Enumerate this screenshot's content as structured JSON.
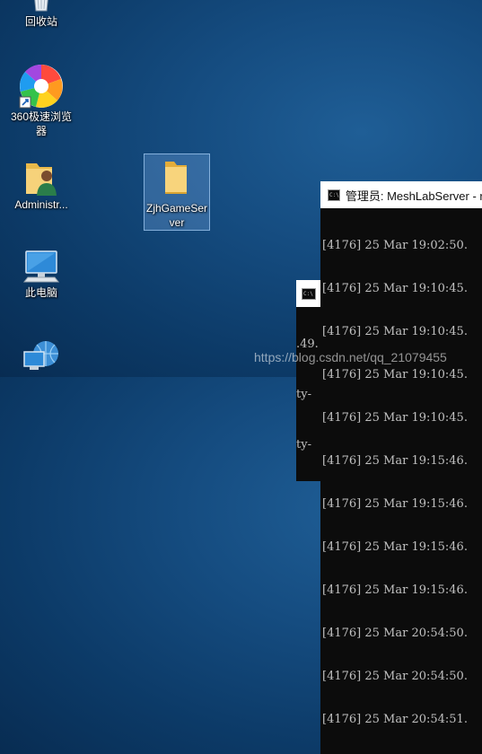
{
  "desktop": {
    "icons": [
      {
        "label": "回收站",
        "icon": "recycle-bin-icon"
      },
      {
        "label": "360极速浏览器",
        "icon": "360-browser-icon"
      },
      {
        "label": "Administr...",
        "icon": "user-folder-icon"
      },
      {
        "label": "ZjhGameServer",
        "icon": "folder-icon"
      },
      {
        "label": "此电脑",
        "icon": "computer-icon"
      },
      {
        "label": "",
        "icon": "network-icon"
      }
    ]
  },
  "windows": {
    "front": {
      "title": "管理员: MeshLabServer - r",
      "lines": [
        "[4176] 25 Mar 19:02:50.",
        "[4176] 25 Mar 19:10:45.",
        "[4176] 25 Mar 19:10:45.",
        "[4176] 25 Mar 19:10:45.",
        "[4176] 25 Mar 19:10:45.",
        "[4176] 25 Mar 19:15:46.",
        "[4176] 25 Mar 19:15:46.",
        "[4176] 25 Mar 19:15:46.",
        "[4176] 25 Mar 19:15:46.",
        "[4176] 25 Mar 20:54:50.",
        "[4176] 25 Mar 20:54:50.",
        "[4176] 25 Mar 20:54:51."
      ]
    },
    "back": {
      "lines": [
        ".49.",
        "ty-",
        "ty-"
      ]
    }
  },
  "watermark": "https://blog.csdn.net/qq_21079455"
}
